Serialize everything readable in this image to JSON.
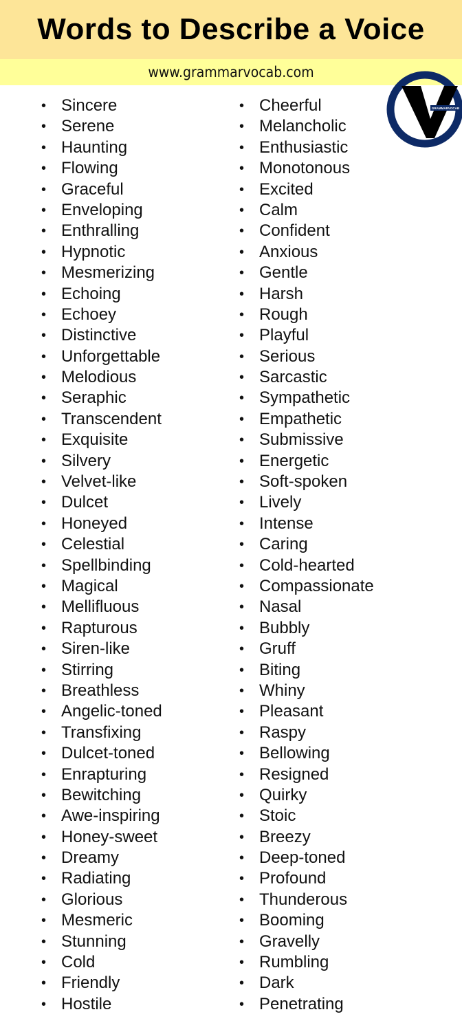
{
  "header": {
    "title": "Words to Describe a Voice",
    "url": "www.grammarvocab.com"
  },
  "logo": {
    "text": "GRAMMARVOCAB",
    "colors": {
      "ring": "#0d2a66",
      "v": "#000000"
    }
  },
  "colors": {
    "title_band": "#fde598",
    "url_band": "#ffff99"
  },
  "left_words": [
    "Sincere",
    "Serene",
    "Haunting",
    "Flowing",
    "Graceful",
    "Enveloping",
    "Enthralling",
    "Hypnotic",
    "Mesmerizing",
    "Echoing",
    "Echoey",
    "Distinctive",
    "Unforgettable",
    "Melodious",
    "Seraphic",
    "Transcendent",
    "Exquisite",
    "Silvery",
    "Velvet-like",
    "Dulcet",
    "Honeyed",
    "Celestial",
    "Spellbinding",
    "Magical",
    "Mellifluous",
    "Rapturous",
    "Siren-like",
    "Stirring",
    "Breathless",
    "Angelic-toned",
    "Transfixing",
    "Dulcet-toned",
    "Enrapturing",
    "Bewitching",
    "Awe-inspiring",
    "Honey-sweet",
    "Dreamy",
    "Radiating",
    "Glorious",
    "Mesmeric",
    "Stunning",
    "Cold",
    "Friendly",
    "Hostile"
  ],
  "right_words": [
    "Cheerful",
    "Melancholic",
    "Enthusiastic",
    "Monotonous",
    "Excited",
    "Calm",
    "Confident",
    "Anxious",
    "Gentle",
    "Harsh",
    "Rough",
    "Playful",
    "Serious",
    "Sarcastic",
    "Sympathetic",
    "Empathetic",
    "Submissive",
    "Energetic",
    "Soft-spoken",
    "Lively",
    "Intense",
    "Caring",
    "Cold-hearted",
    "Compassionate",
    "Nasal",
    "Bubbly",
    "Gruff",
    "Biting",
    "Whiny",
    "Pleasant",
    "Raspy",
    "Bellowing",
    "Resigned",
    "Quirky",
    "Stoic",
    "Breezy",
    "Deep-toned",
    "Profound",
    "Thunderous",
    "Booming",
    "Gravelly",
    "Rumbling",
    "Dark",
    "Penetrating"
  ]
}
